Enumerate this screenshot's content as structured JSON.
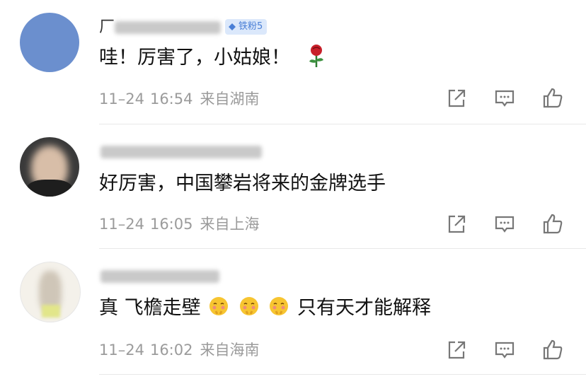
{
  "comments": [
    {
      "username_visible": "厂",
      "badge_label": "铁粉5",
      "text_main": "哇！厉害了，小姑娘！",
      "reaction_icon": "rose-icon",
      "date": "11–24",
      "time": "16:54",
      "location": "来自湖南"
    },
    {
      "username_visible": "",
      "text_main": "好厉害，中国攀岩将来的金牌选手",
      "date": "11–24",
      "time": "16:05",
      "location": "来自上海"
    },
    {
      "username_visible": "",
      "text_prefix": "真 飞檐走壁",
      "text_suffix": "只有天才能解释",
      "emoji_icon": "shy-face-icon",
      "date": "11–24",
      "time": "16:02",
      "location": "来自海南"
    }
  ],
  "actions": {
    "share_icon": "share-icon",
    "comment_icon": "comment-icon",
    "like_icon": "thumbs-up-icon"
  },
  "colors": {
    "text": "#111111",
    "meta": "#9b9b9b",
    "badge_bg": "#dbe8fb",
    "badge_text": "#4a7fd6",
    "avatar1": "#6b8fce"
  }
}
